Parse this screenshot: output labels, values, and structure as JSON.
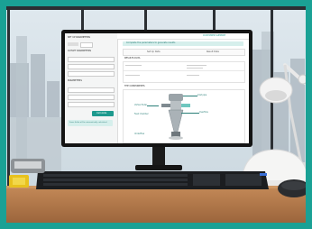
{
  "colors": {
    "frame_teal": "#1aa195",
    "accent_teal": "#1e9a8e",
    "monitor_black": "#141414",
    "desk_wood": "#b57b4c"
  },
  "objects": {
    "keyboard": "keyboard",
    "mouse": "mouse",
    "desk_lamp": "desk lamp",
    "hard_hat": "hard hat",
    "tape_measure": "tape measure",
    "monitor": "monitor"
  },
  "screen": {
    "header_right": "CUSTOMER SUPPORT",
    "left_panel": {
      "section1": "SET UP PARAMETERS",
      "section2": "OUTLET PARAMETERS",
      "section3": "PARAMETERS",
      "button": "Calculate",
      "note": "Some fields will be automatically calculated"
    },
    "banner": "Complete the parameters to generate results",
    "tabs": [
      "Set Up Data",
      "Result Data"
    ],
    "results_title": "RESULTS DATA",
    "diagram_title": "THE COMPONENTS",
    "callouts": [
      "Inlet pipe",
      "Vortex finder",
      "Overflow",
      "Underflow",
      "Feed chamber"
    ]
  }
}
